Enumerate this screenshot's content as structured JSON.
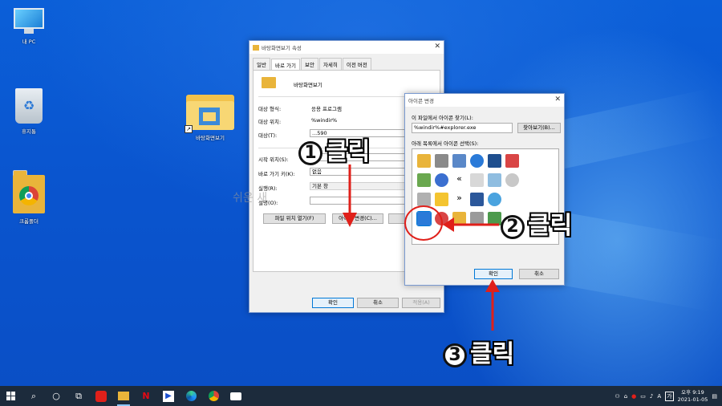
{
  "colors": {
    "accent": "#0078d7",
    "annotation_red": "#e0201a",
    "taskbar": "#1c2b3c",
    "desktop": "#0a55cf"
  },
  "desktop": {
    "icons": [
      {
        "label": "내 PC",
        "icon": "computer-icon"
      },
      {
        "label": "휴지통",
        "icon": "recycle-bin-icon"
      },
      {
        "label": "크롬폴더",
        "icon": "chrome-folder-icon"
      },
      {
        "label": "바탕화면보기",
        "icon": "folder-shortcut-icon"
      }
    ]
  },
  "props_window": {
    "title": "바탕화면보기 속성",
    "tabs": [
      "일반",
      "바로 가기",
      "보안",
      "자세히",
      "이전 버전"
    ],
    "shortcut_name": "바탕화면보기",
    "target_type_label": "대상 형식:",
    "target_type_value": "응용 프로그램",
    "target_location_label": "대상 위치:",
    "target_location_value": "%windir%",
    "target_label": "대상(T):",
    "target_value": "...590",
    "start_in_label": "시작 위치(S):",
    "shortcut_key_label": "바로 가기 키(K):",
    "shortcut_key_value": "없음",
    "run_label": "실행(R):",
    "run_value": "기본 창",
    "comment_label": "설명(O):",
    "open_location_button": "파일 위치 열기(F)",
    "change_icon_button": "아이콘 변경(C)...",
    "ok_button": "확인",
    "cancel_button": "취소",
    "apply_button": "적용(A)"
  },
  "icon_dialog": {
    "title": "아이콘 변경",
    "find_label": "이 파일에서 아이콘 찾기(L):",
    "path_value": "%windir%#explorer.exe",
    "browse_button": "찾아보기(B)...",
    "select_label": "아래 목록에서 아이콘 선택(S):",
    "ok_button": "확인",
    "cancel_button": "취소"
  },
  "annotations": {
    "step1_num": "1",
    "step2_num": "2",
    "step3_num": "3",
    "click_text": "클릭"
  },
  "watermark": "쉬운 새",
  "taskbar": {
    "clock_time": "오후 9:19",
    "clock_date": "2021-01-05",
    "ime": "A",
    "tray_app": "가"
  }
}
